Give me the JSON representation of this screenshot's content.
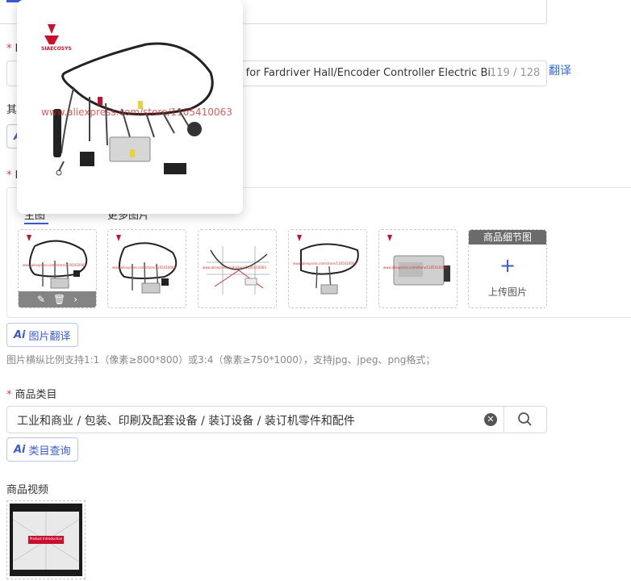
{
  "title_field": {
    "label_partial": "I",
    "value_partial": "ss for Fardriver Hall/Encoder Controller Electric Bi",
    "counter": "119 / 128",
    "translate_link": "翻译"
  },
  "other_label_partial": "其",
  "images_section": {
    "label_partial": "I",
    "main_tab_partial": "主图",
    "more_tab_partial": "更多图片",
    "thumbnails": [
      {
        "watermark": "www.aliexpress.com/store/1105410063"
      },
      {
        "watermark": "www.aliexpress.com/store/1105410063"
      },
      {
        "watermark": "www.aliexpress.com/store/1105410063"
      },
      {
        "watermark": "www.aliexpress.com/store/1105410063"
      },
      {
        "watermark": "www.aliexpress.com/store/1105410063"
      }
    ],
    "detail_upload": {
      "header": "商品细节图",
      "plus": "+",
      "label": "上传图片"
    },
    "ai_translate_label": "图片翻译",
    "hint": "图片横纵比例支持1:1（像素≥800*800）或3:4（像素≥750*1000），支持jpg、jpeg、png格式；"
  },
  "category": {
    "label": "商品类目",
    "value": "工业和商业 / 包装、印刷及配套设备 / 装订设备 / 装订机零件和配件",
    "ai_query_label": "类目查询"
  },
  "video": {
    "label": "商品视频",
    "thumb_text": "Product Introduction"
  },
  "popup": {
    "brand": "SIAECOSYS",
    "watermark": "www.aliexpress.com/store/1105410063"
  },
  "ai_glyph": "Ai",
  "required_mark": "*",
  "colors": {
    "brand_red": "#c8102e",
    "accent_blue": "#3a5bd0"
  }
}
